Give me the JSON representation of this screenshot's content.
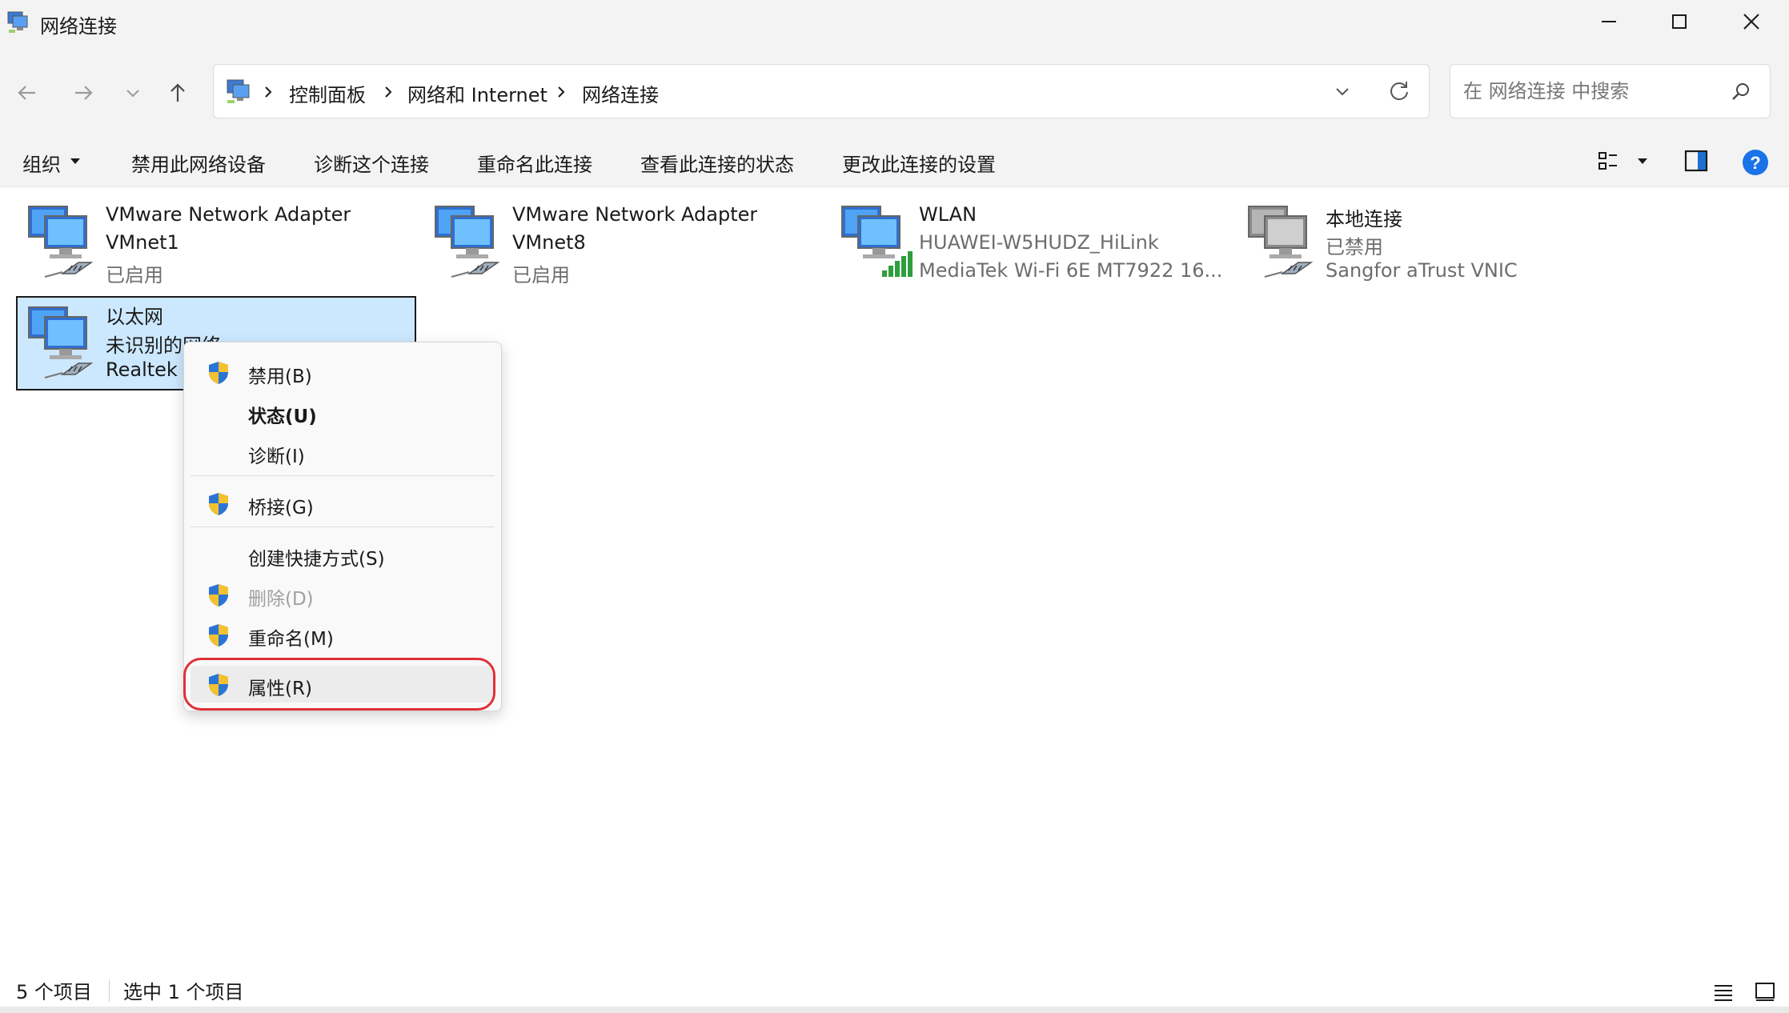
{
  "window": {
    "title": "网络连接"
  },
  "navigation": {
    "breadcrumbs": [
      "控制面板",
      "网络和 Internet",
      "网络连接"
    ],
    "search_placeholder": "在 网络连接 中搜索"
  },
  "commands": {
    "organize": "组织",
    "items": [
      "禁用此网络设备",
      "诊断这个连接",
      "重命名此连接",
      "查看此连接的状态",
      "更改此连接的设置"
    ]
  },
  "connections": [
    {
      "name": "VMware Network Adapter",
      "line2": "VMnet1",
      "line3": "已启用",
      "icon": "wired-network-icon"
    },
    {
      "name": "VMware Network Adapter",
      "line2": "VMnet8",
      "line3": "已启用",
      "icon": "wired-network-icon"
    },
    {
      "name": "WLAN",
      "line2": "HUAWEI-W5HUDZ_HiLink",
      "line3": "MediaTek Wi-Fi 6E MT7922 16...",
      "icon": "wifi-network-icon"
    },
    {
      "name": "本地连接",
      "line2": "已禁用",
      "line3": "Sangfor aTrust VNIC",
      "icon": "disabled-network-icon"
    },
    {
      "name": "以太网",
      "line2": "未识别的网络",
      "line3": "Realtek",
      "icon": "wired-network-icon",
      "selected": true
    }
  ],
  "context_menu": {
    "items": [
      {
        "label": "禁用(B)",
        "shield": true
      },
      {
        "label": "状态(U)",
        "bold": true
      },
      {
        "label": "诊断(I)"
      },
      {
        "label": "桥接(G)",
        "shield": true
      },
      {
        "label": "创建快捷方式(S)"
      },
      {
        "label": "删除(D)",
        "shield": true,
        "disabled": true
      },
      {
        "label": "重命名(M)",
        "shield": true
      },
      {
        "label": "属性(R)",
        "shield": true,
        "highlighted": true
      }
    ]
  },
  "status": {
    "item_count": "5 个项目",
    "selected_count": "选中 1 个项目"
  },
  "colors": {
    "selection": "#cce8ff",
    "highlight_ring": "#e0303a",
    "help": "#1a73e8"
  }
}
